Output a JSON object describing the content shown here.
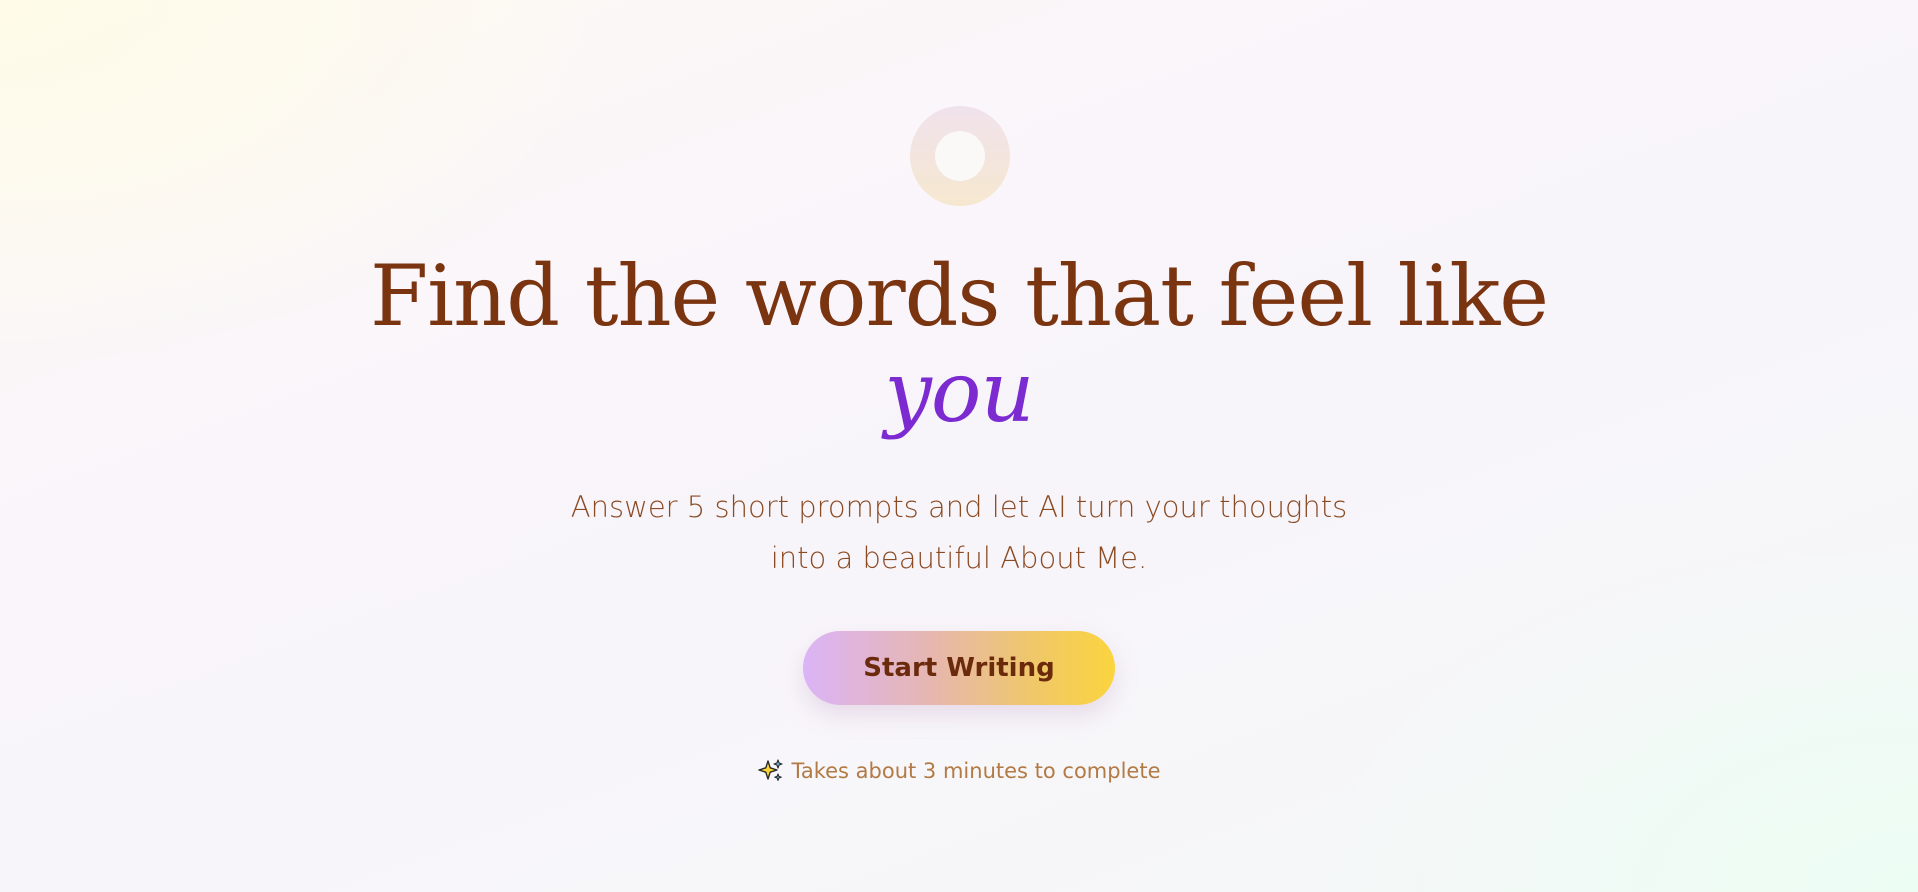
{
  "hero": {
    "headline_main": "Find the words that feel like",
    "headline_accent": "you",
    "subtitle": "Answer 5 short prompts and let AI turn your thoughts into a beautiful About Me.",
    "cta_label": "Start Writing",
    "hint_text": "Takes about 3 minutes to complete",
    "hint_icon": "sparkle-icon",
    "logo_icon": "ring-logo-icon"
  },
  "colors": {
    "headline": "#7a3410",
    "accent": "#7c2bd1",
    "subtitle": "#8a4a22",
    "cta_gradient_start": "#dbb4f7",
    "cta_gradient_end": "#fbd43e",
    "cta_text": "#6b2a0c",
    "hint": "#b27a44"
  }
}
